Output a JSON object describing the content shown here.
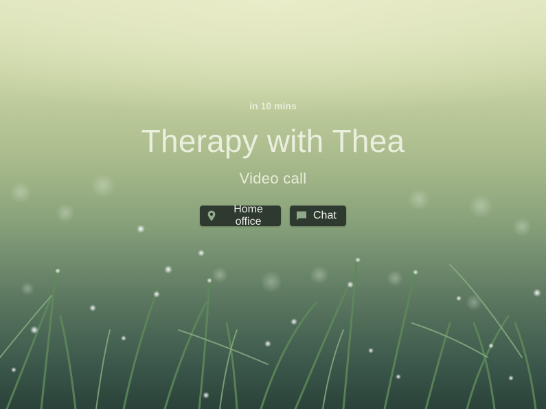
{
  "event": {
    "eta": "in 10 mins",
    "title": "Therapy with Thea",
    "type": "Video call"
  },
  "actions": {
    "location": {
      "label": "Home office",
      "icon": "location-pin-icon"
    },
    "chat": {
      "label": "Chat",
      "icon": "chat-bubble-icon"
    }
  },
  "colors": {
    "chip_background": "#263028",
    "icon_accent": "#8fa98a",
    "text": "#eef1e6"
  }
}
